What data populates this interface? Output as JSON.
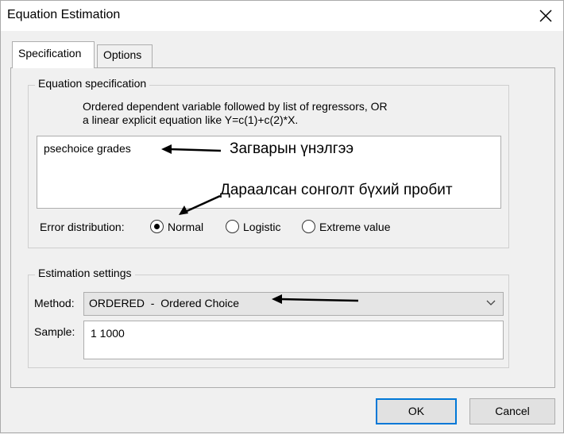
{
  "window": {
    "title": "Equation Estimation"
  },
  "tabs": [
    {
      "label": "Specification",
      "active": true
    },
    {
      "label": "Options",
      "active": false
    }
  ],
  "equation_spec": {
    "group_label": "Equation specification",
    "instruction_line1": "Ordered dependent variable followed by list of regressors, OR",
    "instruction_line2": "a linear explicit equation like Y=c(1)+c(2)*X.",
    "value": "psechoice grades"
  },
  "error_distribution": {
    "label": "Error distribution:",
    "options": [
      {
        "label": "Normal",
        "selected": true
      },
      {
        "label": "Logistic",
        "selected": false
      },
      {
        "label": "Extreme value",
        "selected": false
      }
    ]
  },
  "estimation_settings": {
    "group_label": "Estimation settings",
    "method_label": "Method:",
    "method_value": "ORDERED  -  Ordered Choice",
    "sample_label": "Sample:",
    "sample_value": "1 1000"
  },
  "buttons": {
    "ok": "OK",
    "cancel": "Cancel"
  },
  "annotations": {
    "model_eval": "Загварын үнэлгээ",
    "ordered_probit": "Дараалсан сонголт бүхий пробит"
  },
  "colors": {
    "focus_border": "#0078d7",
    "annotation": "#000000"
  },
  "icons": {
    "close": "close-icon",
    "dropdown": "chevron-down-icon"
  }
}
